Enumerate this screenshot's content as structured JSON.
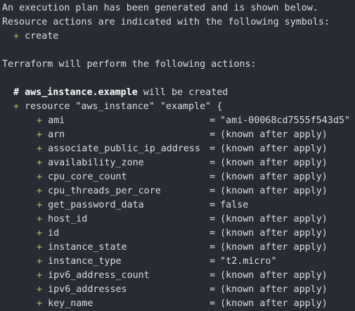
{
  "terminal": {
    "intro_lines": [
      "An execution plan has been generated and is shown below.",
      "Resource actions are indicated with the following symbols:"
    ],
    "symbol_line": {
      "symbol": "+",
      "label": "create"
    },
    "perform_line": "Terraform will perform the following actions:",
    "comment": {
      "hash": "#",
      "resource_name": "aws_instance.example",
      "suffix": " will be created"
    },
    "resource_line": {
      "symbol": "+",
      "text": "resource \"aws_instance\" \"example\" {"
    },
    "attributes": [
      {
        "symbol": "+",
        "name": "ami",
        "eq": "=",
        "value": "\"ami-00068cd7555f543d5\""
      },
      {
        "symbol": "+",
        "name": "arn",
        "eq": "=",
        "value": "(known after apply)"
      },
      {
        "symbol": "+",
        "name": "associate_public_ip_address",
        "eq": "=",
        "value": "(known after apply)"
      },
      {
        "symbol": "+",
        "name": "availability_zone",
        "eq": "=",
        "value": "(known after apply)"
      },
      {
        "symbol": "+",
        "name": "cpu_core_count",
        "eq": "=",
        "value": "(known after apply)"
      },
      {
        "symbol": "+",
        "name": "cpu_threads_per_core",
        "eq": "=",
        "value": "(known after apply)"
      },
      {
        "symbol": "+",
        "name": "get_password_data",
        "eq": "=",
        "value": "false"
      },
      {
        "symbol": "+",
        "name": "host_id",
        "eq": "=",
        "value": "(known after apply)"
      },
      {
        "symbol": "+",
        "name": "id",
        "eq": "=",
        "value": "(known after apply)"
      },
      {
        "symbol": "+",
        "name": "instance_state",
        "eq": "=",
        "value": "(known after apply)"
      },
      {
        "symbol": "+",
        "name": "instance_type",
        "eq": "=",
        "value": "\"t2.micro\""
      },
      {
        "symbol": "+",
        "name": "ipv6_address_count",
        "eq": "=",
        "value": "(known after apply)"
      },
      {
        "symbol": "+",
        "name": "ipv6_addresses",
        "eq": "=",
        "value": "(known after apply)"
      },
      {
        "symbol": "+",
        "name": "key_name",
        "eq": "=",
        "value": "(known after apply)"
      }
    ],
    "colors": {
      "background": "#272c34",
      "text": "#dcdfe4",
      "plus": "#a7c26c",
      "bold": "#ffffff"
    }
  }
}
